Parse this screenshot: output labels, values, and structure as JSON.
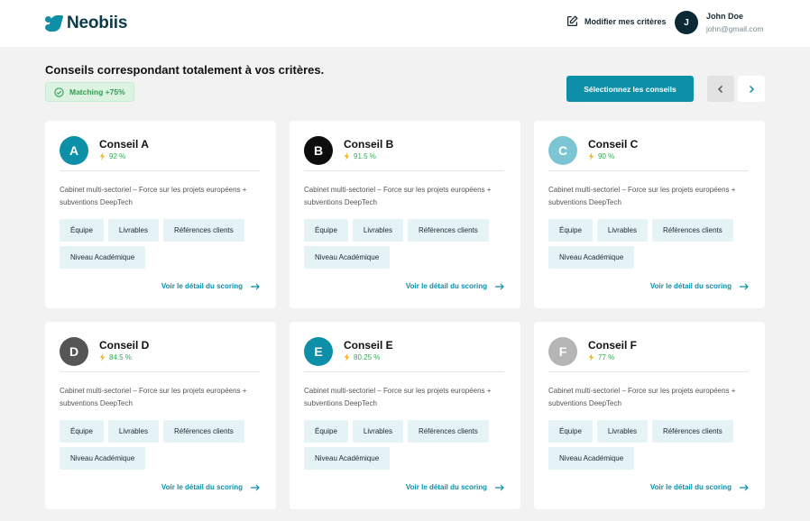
{
  "header": {
    "brand": "Neobiis",
    "edit_criteria": "Modifier mes critères",
    "user": {
      "initial": "J",
      "name": "John Doe",
      "email": "john@gmail.com"
    }
  },
  "main": {
    "title": "Conseils correspondant totalement à vos critères.",
    "matching_badge": "Matching +75%",
    "select_button": "Sélectionnez les conseils"
  },
  "card_common": {
    "description": "Cabinet multi-sectoriel – Force sur les projets européens + subventions DeepTech",
    "tags": [
      "Équipe",
      "Livrables",
      "Références clients",
      "Niveau Académique"
    ],
    "link": "Voir le détail du scoring"
  },
  "cards": [
    {
      "initial": "A",
      "name": "Conseil A",
      "score": "92 %",
      "color": "#0e8fa8"
    },
    {
      "initial": "B",
      "name": "Conseil B",
      "score": "91.5 %",
      "color": "#0d0d0d"
    },
    {
      "initial": "C",
      "name": "Conseil C",
      "score": "90 %",
      "color": "#7cc6d4"
    },
    {
      "initial": "D",
      "name": "Conseil D",
      "score": "84.5 %",
      "color": "#555555"
    },
    {
      "initial": "E",
      "name": "Conseil E",
      "score": "80.25 %",
      "color": "#0e8fa8"
    },
    {
      "initial": "F",
      "name": "Conseil F",
      "score": "77 %",
      "color": "#b5b5b5"
    }
  ],
  "colors": {
    "accent": "#0e8fa8",
    "success": "#2e9f52",
    "bolt": "#f2b51a"
  },
  "icons": {
    "edit": "edit-icon",
    "check": "check-circle-icon",
    "bolt": "bolt-icon",
    "arrow": "arrow-right-icon"
  }
}
